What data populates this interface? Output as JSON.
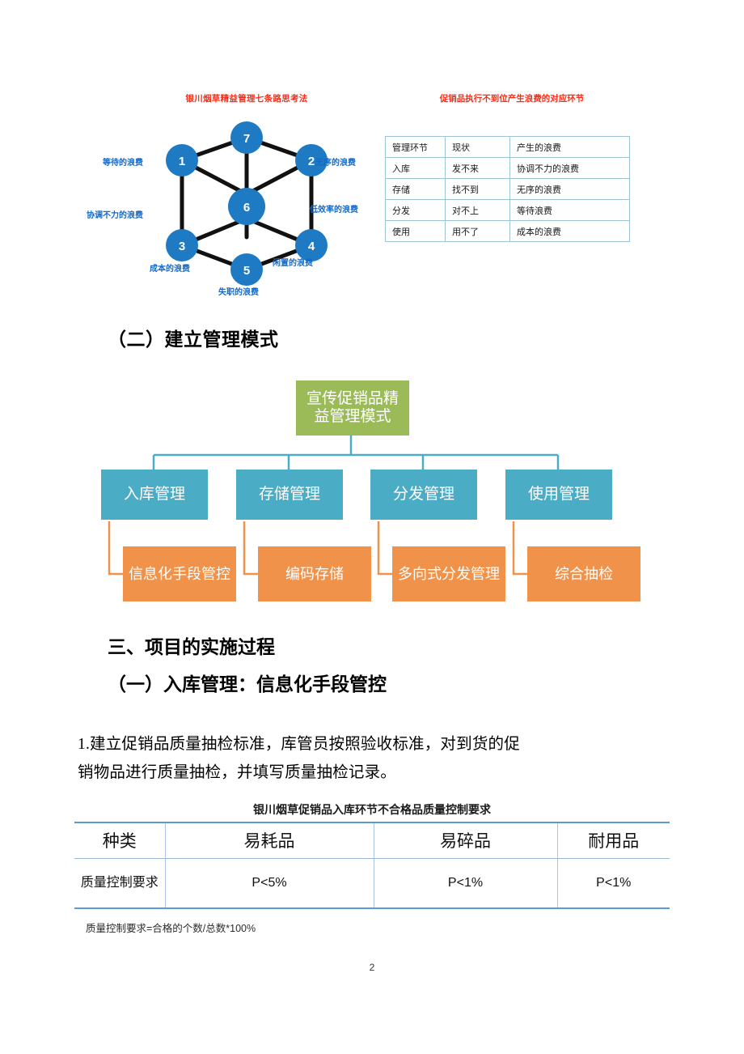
{
  "figure1": {
    "left": {
      "title": "银川烟草精益管理七条路思考法",
      "nodes": [
        {
          "id": "7",
          "label": "7"
        },
        {
          "id": "1",
          "label": "1"
        },
        {
          "id": "2",
          "label": "2"
        },
        {
          "id": "6",
          "label": "6"
        },
        {
          "id": "3",
          "label": "3"
        },
        {
          "id": "4",
          "label": "4"
        },
        {
          "id": "5",
          "label": "5"
        }
      ],
      "labels": [
        {
          "key": "waiting",
          "text": "等待的浪费"
        },
        {
          "key": "disorder",
          "text": "无序的浪费"
        },
        {
          "key": "coordination",
          "text": "协调不力的浪费"
        },
        {
          "key": "inefficiency",
          "text": "低效率的浪费"
        },
        {
          "key": "cost",
          "text": "成本的浪费"
        },
        {
          "key": "idle",
          "text": "闲置的浪费"
        },
        {
          "key": "dereliction",
          "text": "失职的浪费"
        }
      ]
    },
    "right": {
      "title": "促销品执行不到位产生浪费的对应环节",
      "table": {
        "headers": [
          "管理环节",
          "现状",
          "产生的浪费"
        ],
        "rows": [
          [
            "入库",
            "发不来",
            "协调不力的浪费"
          ],
          [
            "存储",
            "找不到",
            "无序的浪费"
          ],
          [
            "分发",
            "对不上",
            "等待浪费"
          ],
          [
            "使用",
            "用不了",
            "成本的浪费"
          ]
        ]
      }
    }
  },
  "heading_er": "（二）建立管理模式",
  "org_chart": {
    "root": "宣传促销品精益管理模式",
    "branches": [
      {
        "top": "入库管理",
        "bottom": "信息化手段管控"
      },
      {
        "top": "存储管理",
        "bottom": "编码存储"
      },
      {
        "top": "分发管理",
        "bottom": "多向式分发管理"
      },
      {
        "top": "使用管理",
        "bottom": "综合抽检"
      }
    ],
    "colors": {
      "root": "#9BBB59",
      "top": "#4BACC6",
      "bottom": "#F0924A",
      "connector_top": "#4BACC6",
      "connector_bottom": "#F0924A"
    }
  },
  "heading_san": "三、项目的实施过程",
  "heading_yi": "（一）入库管理：信息化手段管控",
  "paragraph": {
    "line1": "1.建立促销品质量抽检标准，库管员按照验收标准，对到货的促",
    "line2": "销物品进行质量抽检，并填写质量抽检记录。"
  },
  "bottom_table": {
    "title": "银川烟草促销品入库环节不合格品质量控制要求",
    "header_row": [
      "种类",
      "易耗品",
      "易碎品",
      "耐用品"
    ],
    "data_row_label": "质量控制要求",
    "data_row": [
      "P<5%",
      "P<1%",
      "P<1%"
    ],
    "note": "质量控制要求=合格的个数/总数*100%"
  },
  "page_number": "2"
}
